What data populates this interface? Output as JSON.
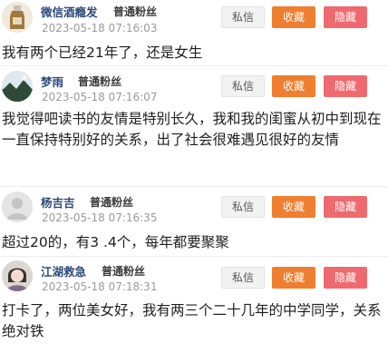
{
  "comments": [
    {
      "name": "微信酒瘾发",
      "level": "普通粉丝",
      "time": "2023-05-18 07:16:03",
      "text": "我有两个已经21年了，还是女生",
      "avatar_icon": "bottle-avatar"
    },
    {
      "name": "梦雨",
      "level": "普通粉丝",
      "time": "2023-05-18 07:16:07",
      "text": "我觉得吧读书的友情是特别长久，我和我的闺蜜从初中到现在一直保持特别好的关系，出了社会很难遇见很好的友情",
      "avatar_icon": "landscape-avatar"
    },
    {
      "name": "杨吉吉",
      "level": "普通粉丝",
      "time": "2023-05-18 07:16:35",
      "text": "超过20的，有3 .4个，每年都要聚聚",
      "avatar_icon": "default-user-avatar"
    },
    {
      "name": "江湖救急",
      "level": "普通粉丝",
      "time": "2023-05-18 07:18:31",
      "text": "打卡了，两位美女好，我有两三个二十几年的中学同学，关系绝对铁",
      "avatar_icon": "photo-avatar"
    }
  ],
  "buttons": {
    "message": "私信",
    "favorite": "收藏",
    "hide": "隐藏"
  },
  "colors": {
    "favorite": "#ef7e2f",
    "hide": "#ef6a6e",
    "name": "#2c4a7a",
    "time": "#9a9a9a"
  }
}
